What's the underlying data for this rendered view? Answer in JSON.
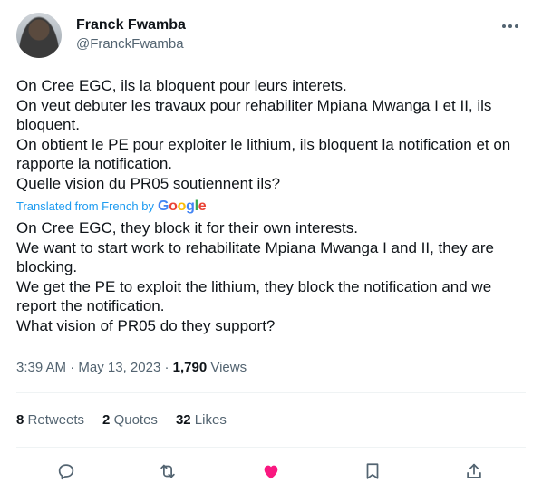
{
  "author": {
    "name": "Franck Fwamba",
    "handle": "@FranckFwamba"
  },
  "tweet": {
    "text": "On Cree EGC, ils la bloquent pour leurs interets.\nOn veut debuter les travaux pour rehabiliter Mpiana Mwanga I et II, ils bloquent.\nOn obtient le PE pour exploiter le lithium, ils bloquent la notification et on rapporte la notification.\nQuelle vision du PR05 soutiennent ils?",
    "translated_label": "Translated from French by",
    "translation_provider": "Google",
    "translation": "On Cree EGC, they block it for their own interests.\nWe want to start work to rehabilitate Mpiana Mwanga I and II, they are blocking.\nWe get the PE to exploit the lithium, they block the notification and we report the notification.\nWhat vision of PR05 do they support?"
  },
  "meta": {
    "time": "3:39 AM",
    "date": "May 13, 2023",
    "separator": "·",
    "views_count": "1,790",
    "views_label": "Views"
  },
  "stats": {
    "retweets_count": "8",
    "retweets_label": "Retweets",
    "quotes_count": "2",
    "quotes_label": "Quotes",
    "likes_count": "32",
    "likes_label": "Likes"
  },
  "actions": {
    "icons": [
      "reply-icon",
      "retweet-icon",
      "like-icon",
      "bookmark-icon",
      "share-icon"
    ],
    "liked": true
  },
  "colors": {
    "accent": "#1d9bf0",
    "like": "#f91880",
    "secondary_text": "#536471",
    "divider": "#eff3f4"
  }
}
